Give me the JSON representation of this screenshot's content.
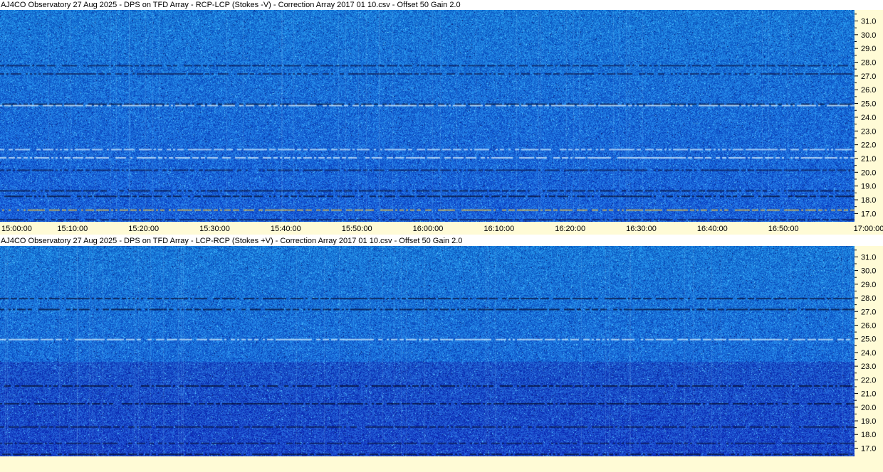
{
  "colors": {
    "axis_background": "#fffbd6",
    "spectrogram_base": "#1f5fd8"
  },
  "panels": [
    {
      "title": "AJ4CO Observatory 27 Aug 2025  -  DPS on TFD Array  -  RCP-LCP (Stokes -V)  -  Correction Array 2017 01 10.csv  -  Offset 50  Gain 2.0",
      "x_tick_labels": [
        "15:00:00",
        "15:10:00",
        "15:20:00",
        "15:30:00",
        "15:40:00",
        "15:50:00",
        "16:00:00",
        "16:10:00",
        "16:20:00",
        "16:30:00",
        "16:40:00",
        "16:50:00",
        "17:00:00"
      ],
      "y_tick_labels": [
        "31.0",
        "30.0",
        "29.0",
        "28.0",
        "27.0",
        "26.0",
        "25.0",
        "24.0",
        "23.0",
        "22.0",
        "21.0",
        "20.0",
        "19.0",
        "18.0",
        "17.0"
      ]
    },
    {
      "title": "AJ4CO Observatory 27 Aug 2025  -  DPS on TFD Array  -  LCP-RCP (Stokes +V)  -  Correction Array 2017 01 10.csv  -  Offset 50  Gain 2.0",
      "x_tick_labels": [],
      "y_tick_labels": [
        "31.0",
        "30.0",
        "29.0",
        "28.0",
        "27.0",
        "26.0",
        "25.0",
        "24.0",
        "23.0",
        "22.0",
        "21.0",
        "20.0",
        "19.0",
        "18.0",
        "17.0"
      ]
    }
  ],
  "chart_data": [
    {
      "type": "heatmap",
      "title": "AJ4CO Observatory 27 Aug 2025  -  DPS on TFD Array  -  RCP-LCP (Stokes -V)  -  Correction Array 2017 01 10.csv  -  Offset 50  Gain 2.0",
      "x_range": [
        "15:00:00",
        "17:00:00"
      ],
      "y_range": [
        16.4,
        31.8
      ],
      "x_ticks": [
        "15:00:00",
        "15:10:00",
        "15:20:00",
        "15:30:00",
        "15:40:00",
        "15:50:00",
        "16:00:00",
        "16:10:00",
        "16:20:00",
        "16:30:00",
        "16:40:00",
        "16:50:00",
        "17:00:00"
      ],
      "y_ticks": [
        31.0,
        30.0,
        29.0,
        28.0,
        27.0,
        26.0,
        25.0,
        24.0,
        23.0,
        22.0,
        21.0,
        20.0,
        19.0,
        18.0,
        17.0
      ],
      "horizontal_bands": [
        {
          "freq": 27.8,
          "color": "#0a1a55"
        },
        {
          "freq": 27.2,
          "color": "#101e55"
        },
        {
          "freq": 25.0,
          "color": "#05103a"
        },
        {
          "freq": 24.9,
          "color": "#d8f0ff"
        },
        {
          "freq": 21.7,
          "color": "#cfeaff"
        },
        {
          "freq": 21.1,
          "color": "#e0f4ff"
        },
        {
          "freq": 20.2,
          "color": "#0c1a50"
        },
        {
          "freq": 18.7,
          "color": "#0a1440"
        },
        {
          "freq": 18.3,
          "color": "#050c30"
        },
        {
          "freq": 17.3,
          "color": "#e8c040"
        },
        {
          "freq": 16.6,
          "color": "#0c1a50"
        }
      ]
    },
    {
      "type": "heatmap",
      "title": "AJ4CO Observatory 27 Aug 2025  -  DPS on TFD Array  -  LCP-RCP (Stokes +V)  -  Correction Array 2017 01 10.csv  -  Offset 50  Gain 2.0",
      "x_range": [
        "15:00:00",
        "17:00:00"
      ],
      "y_range": [
        16.4,
        31.8
      ],
      "y_ticks": [
        31.0,
        30.0,
        29.0,
        28.0,
        27.0,
        26.0,
        25.0,
        24.0,
        23.0,
        22.0,
        21.0,
        20.0,
        19.0,
        18.0,
        17.0
      ],
      "horizontal_bands": [
        {
          "freq": 28.0,
          "color": "#0a1440"
        },
        {
          "freq": 27.2,
          "color": "#050c30"
        },
        {
          "freq": 25.0,
          "color": "#d8f0ff"
        },
        {
          "freq": 21.6,
          "color": "#050c30"
        },
        {
          "freq": 20.3,
          "color": "#050c30"
        },
        {
          "freq": 18.6,
          "color": "#0a1440"
        },
        {
          "freq": 17.4,
          "color": "#0c1a50"
        },
        {
          "freq": 16.6,
          "color": "#050c30"
        }
      ]
    }
  ]
}
